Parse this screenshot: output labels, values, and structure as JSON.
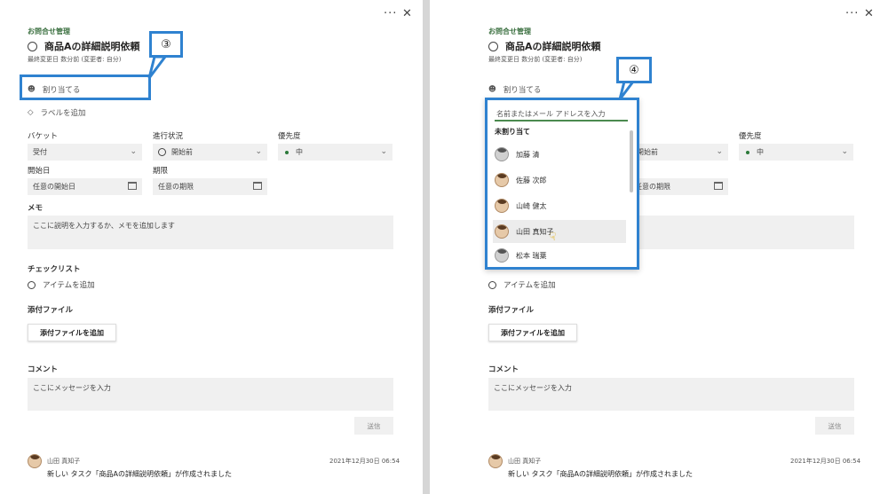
{
  "panel": {
    "more": "···",
    "close": "✕",
    "breadcrumb": "お問合せ管理",
    "task_title": "商品Aの詳細説明依頼",
    "last_modified": "最終変更日 数分前 (変更者: 自分)",
    "assign": "割り当てる",
    "add_label": "ラベルを追加",
    "bucket_label": "バケット",
    "bucket_value": "受付",
    "progress_label": "進行状況",
    "progress_value": "開始前",
    "priority_label": "優先度",
    "priority_value": "中",
    "start_label": "開始日",
    "start_placeholder": "任意の開始日",
    "due_label": "期限",
    "due_placeholder": "任意の期限",
    "memo_label": "メモ",
    "memo_placeholder": "ここに説明を入力するか、メモを追加します",
    "checklist_label": "チェックリスト",
    "checklist_add": "アイテムを追加",
    "attach_label": "添付ファイル",
    "attach_button": "添付ファイルを追加",
    "comment_label": "コメント",
    "comment_placeholder": "ここにメッセージを入力",
    "send": "送信",
    "comment_author": "山田 真知子",
    "comment_time": "2021年12月30日 06:54",
    "comment_text": "新しい タスク「商品Aの詳細説明依頼」が作成されました"
  },
  "callouts": {
    "step3": "③",
    "step4": "④"
  },
  "assign_dropdown": {
    "placeholder": "名前またはメール アドレスを入力",
    "section": "未割り当て",
    "people": [
      "加藤 清",
      "佐藤 次郎",
      "山崎 健太",
      "山田 真知子",
      "松本 瑞葉"
    ]
  },
  "colors": {
    "highlight": "#2f82d0",
    "accent": "#2c7a3a"
  }
}
